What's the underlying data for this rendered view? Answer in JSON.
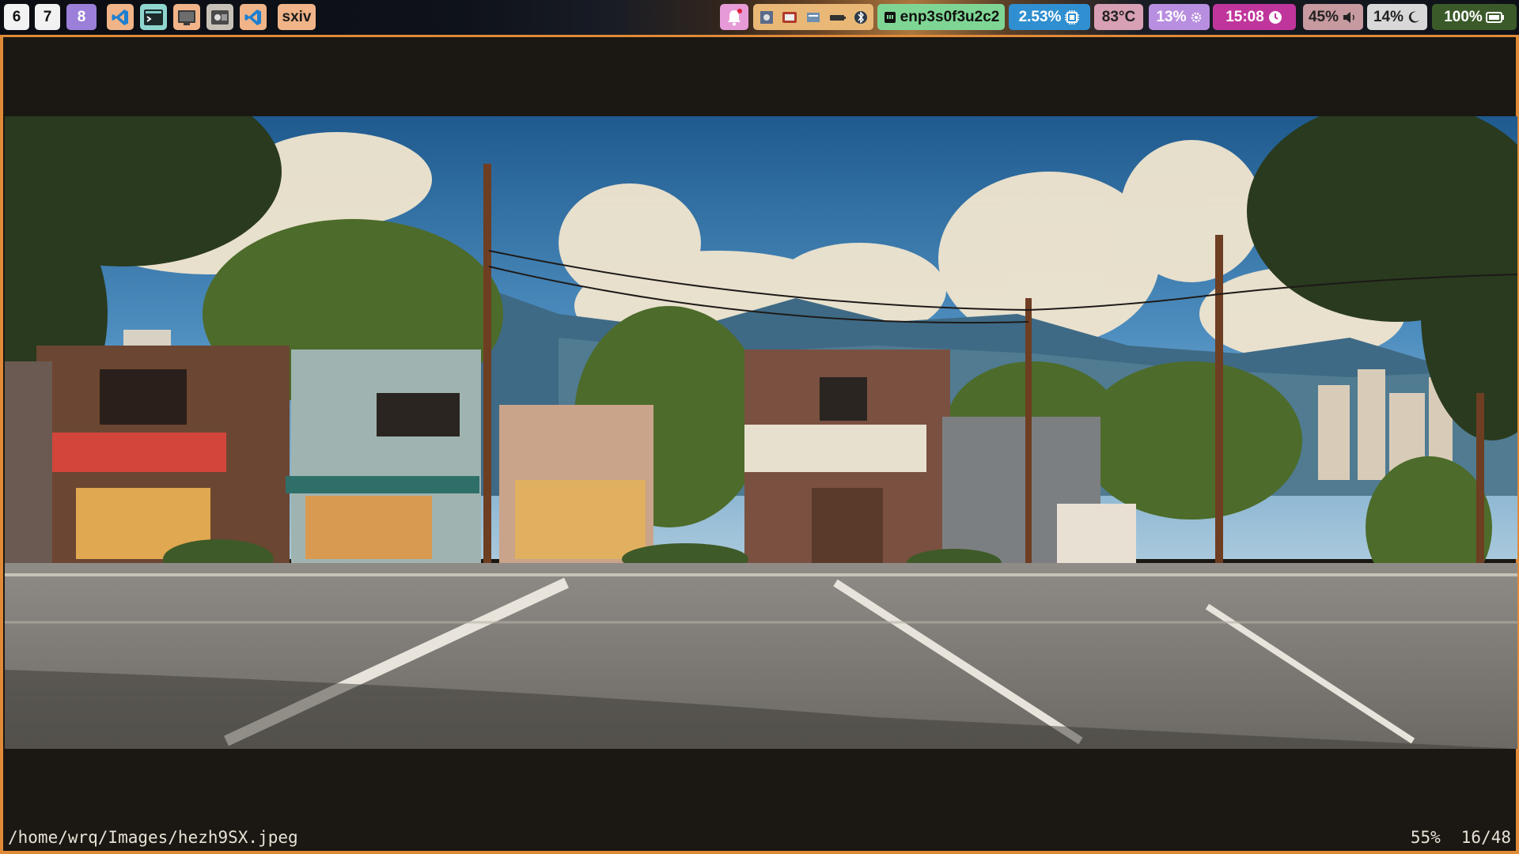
{
  "taskbar": {
    "workspaces": [
      "6",
      "7",
      "8"
    ],
    "active_workspace": "8",
    "window_title": "sxiv",
    "tray_icons": [
      "notification-bell-icon",
      "app-icon",
      "app-icon",
      "app-icon",
      "battery-tray-icon",
      "bluetooth-icon"
    ],
    "network": "enp3s0f3u2c2",
    "cpu": "2.53%",
    "temperature": "83°C",
    "memory": "13%",
    "clock": "15:08",
    "volume": "45%",
    "brightness": "14%",
    "battery": "100%"
  },
  "viewer": {
    "file_path": "/home/wrq/Images/hezh9SX.jpeg",
    "zoom": "55%",
    "position": "16/48"
  },
  "colors": {
    "border_accent": "#e08a38",
    "network_bg": "#7fd694",
    "cpu_bg": "#2f8fd0",
    "temp_bg": "#d8a0b4",
    "memory_bg": "#b88ee0",
    "clock_bg": "#c0359c",
    "volume_bg": "#c79aa0",
    "brightness_bg": "#d8d8d8",
    "battery_bg": "#3b5a2a"
  }
}
